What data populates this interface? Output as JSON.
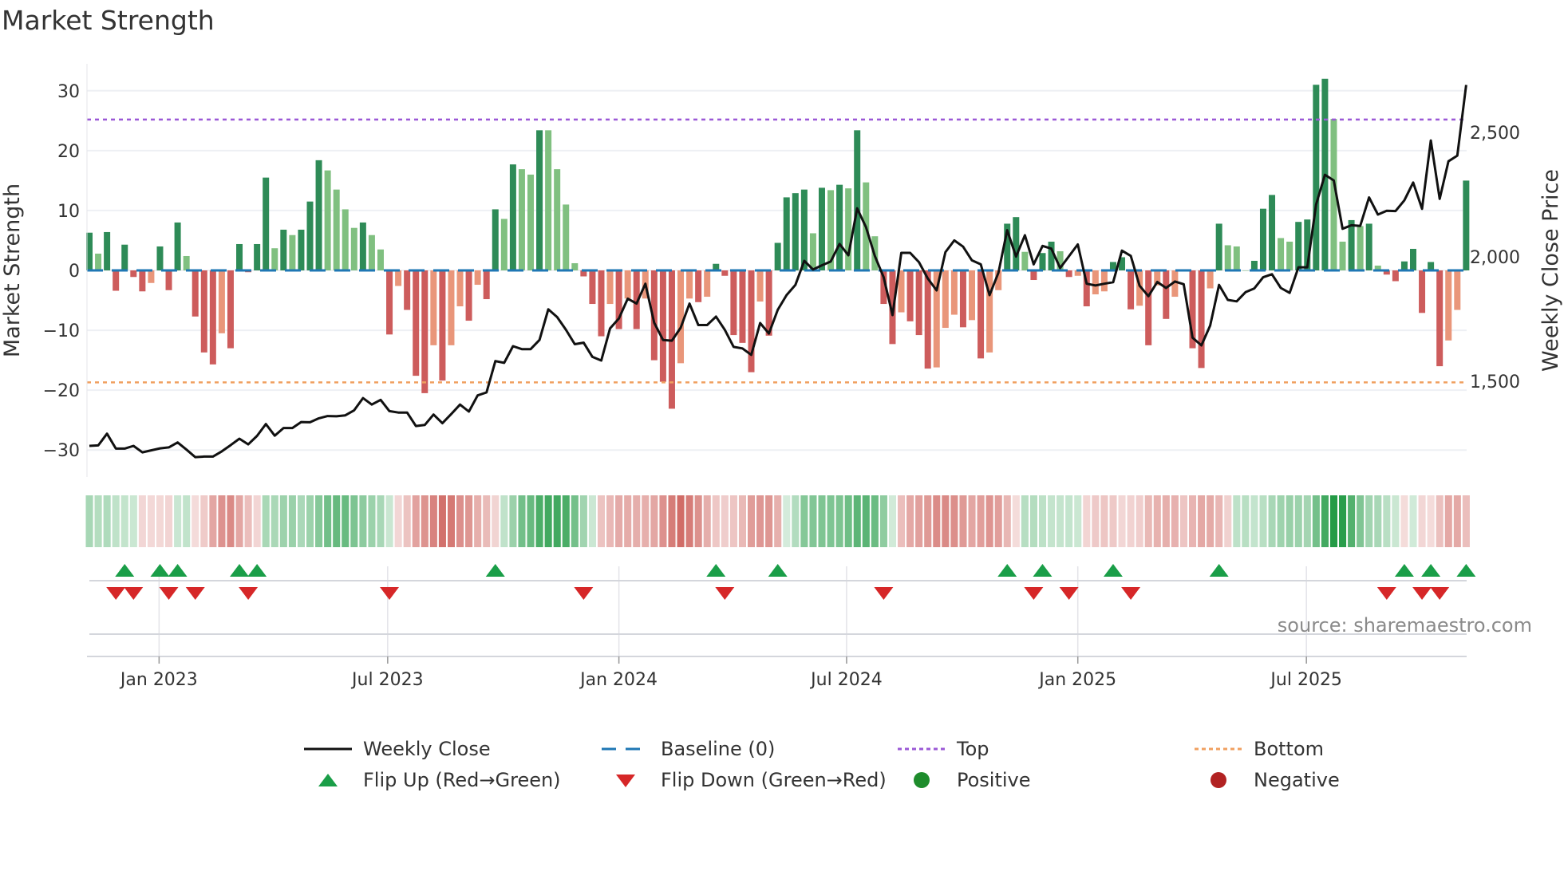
{
  "title": "Market Strength",
  "source": "source: sharemaestro.com",
  "legend": {
    "weekly_close": "Weekly Close",
    "baseline": "Baseline (0)",
    "top": "Top",
    "bottom": "Bottom",
    "flip_up": "Flip Up (Red→Green)",
    "flip_down": "Flip Down (Green→Red)",
    "positive": "Positive",
    "negative": "Negative"
  },
  "colors": {
    "strong_up": "#2e8b57",
    "weak_up": "#80c080",
    "strong_down": "#cd5c5c",
    "weak_down": "#e9967a",
    "baseline": "#1f77b4",
    "top": "#9b59d6",
    "bottom": "#f0a060",
    "line": "#111111",
    "flip_up": "#1a9e48",
    "flip_down": "#d62728",
    "positive": "#1e8c2c",
    "negative": "#b22222"
  },
  "chart_data": {
    "type": "bar",
    "title": "Market Strength",
    "ylabel": "Market Strength",
    "y2label": "Weekly Close Price",
    "ylim": [
      -34.5,
      34.5
    ],
    "y2lim": [
      1115,
      2776
    ],
    "yticks": [
      "30",
      "20",
      "10",
      "0",
      "−10",
      "−20",
      "−30"
    ],
    "ytick_values": [
      30,
      20,
      10,
      0,
      -10,
      -20,
      -30
    ],
    "y2ticks": [
      "2,500",
      "2,000",
      "1,500"
    ],
    "y2tick_values": [
      2500,
      2000,
      1500
    ],
    "xticks": [
      "Jan 2023",
      "Jul 2023",
      "Jan 2024",
      "Jul 2024",
      "Jan 2025",
      "Jul 2025"
    ],
    "xtick_week_index": [
      7.9,
      33.8,
      60,
      85.8,
      112,
      137.9
    ],
    "frequency": "weekly",
    "top_level": 25.2,
    "bottom_level": -18.7,
    "baseline": 0,
    "strength": [
      6.3,
      2.8,
      6.4,
      -3.4,
      4.3,
      -1.1,
      -3.5,
      -2.1,
      4,
      -3.3,
      8,
      2.4,
      -7.7,
      -13.7,
      -15.7,
      -10.5,
      -13,
      4.4,
      -0.3,
      4.4,
      15.5,
      3.7,
      6.8,
      5.9,
      6.8,
      11.5,
      18.4,
      16.7,
      13.5,
      10.2,
      7.1,
      8,
      5.9,
      3.5,
      -10.7,
      -2.6,
      -6.6,
      -17.6,
      -20.5,
      -12.5,
      -18.4,
      -12.5,
      -6,
      -8.4,
      -2.4,
      -4.8,
      10.2,
      8.6,
      17.7,
      16.9,
      16,
      23.4,
      23.4,
      16.9,
      11,
      1.2,
      -1,
      -5.6,
      -11,
      -5.6,
      -9.8,
      -4.7,
      -9.8,
      -4.7,
      -15,
      -18.6,
      -23.1,
      -15.5,
      -4.7,
      -5.3,
      -4.4,
      1.1,
      -0.9,
      -10.8,
      -12.1,
      -17,
      -5.2,
      -10.9,
      4.6,
      12.2,
      12.9,
      13.5,
      6.2,
      13.8,
      13.4,
      14.3,
      13.7,
      23.4,
      14.7,
      5.7,
      -5.6,
      -12.3,
      -7,
      -8.5,
      -10.8,
      -16.4,
      -16.2,
      -9.6,
      -7.4,
      -9.5,
      -8.3,
      -14.7,
      -13.7,
      -3.3,
      7.8,
      8.9,
      3.1,
      -1.6,
      2.9,
      4.8,
      3.2,
      -1.1,
      -0.9,
      -6,
      -4,
      -3.5,
      1.4,
      2.2,
      -6.5,
      -5.9,
      -12.5,
      -2.5,
      -8.1,
      -4.4,
      0,
      -13,
      -16.3,
      -3,
      7.8,
      4.2,
      4,
      0,
      1.6,
      10.3,
      12.6,
      5.4,
      4.8,
      8.1,
      8.5,
      31,
      32,
      25.3,
      4.8,
      8.4,
      7.4,
      7.8,
      0.8,
      -0.7,
      -1.8,
      1.5,
      3.6,
      -7.1,
      1.4,
      -16,
      -11.7,
      -6.6,
      15
    ],
    "strength_class": "GgGRGRRrGRGgRRRrRGRGGgGgGGGggggGggRrRRRrRrrRrRGgGggGgg",
    "strength_class_2": "ggRRRrRrRrRRRrrRrGRRRRrRGGGGgGgGgGggRRrRRRrrrRrRrrGGgRGGgRrRrrG",
    "strength_class_3": "GRrRrRrrRRrGgggGGGggGGGGggGgGgRRGGRGRrrG",
    "weekly_close": [
      1240,
      1242,
      1289,
      1229,
      1229,
      1240,
      1214,
      1222,
      1230,
      1234,
      1254,
      1225,
      1195,
      1197,
      1197,
      1218,
      1243,
      1269,
      1246,
      1280,
      1328,
      1281,
      1312,
      1312,
      1336,
      1335,
      1351,
      1360,
      1359,
      1363,
      1383,
      1432,
      1406,
      1425,
      1380,
      1374,
      1374,
      1320,
      1324,
      1366,
      1331,
      1368,
      1406,
      1378,
      1443,
      1455,
      1581,
      1574,
      1641,
      1629,
      1629,
      1666,
      1789,
      1758,
      1707,
      1649,
      1655,
      1598,
      1583,
      1712,
      1752,
      1832,
      1812,
      1892,
      1735,
      1666,
      1663,
      1715,
      1812,
      1726,
      1726,
      1760,
      1707,
      1638,
      1632,
      1606,
      1734,
      1692,
      1787,
      1846,
      1887,
      1984,
      1949,
      1966,
      1981,
      2052,
      2006,
      2195,
      2119,
      2004,
      1918,
      1766,
      2016,
      2016,
      1979,
      1913,
      1865,
      2019,
      2066,
      2041,
      1986,
      1970,
      1846,
      1936,
      2107,
      2001,
      2087,
      1970,
      2044,
      2033,
      1955,
      2003,
      2050,
      1892,
      1885,
      1892,
      1898,
      2025,
      2004,
      1884,
      1842,
      1899,
      1875,
      1901,
      1890,
      1675,
      1644,
      1724,
      1887,
      1827,
      1821,
      1858,
      1873,
      1918,
      1930,
      1875,
      1855,
      1958,
      1958,
      2210,
      2330,
      2307,
      2113,
      2127,
      2124,
      2239,
      2170,
      2185,
      2184,
      2227,
      2299,
      2193,
      2468,
      2233,
      2384,
      2407,
      2691
    ],
    "flip_up_week_index": [
      4,
      8,
      10,
      17,
      19,
      46,
      71,
      78,
      104,
      108,
      116,
      128,
      149,
      152,
      156
    ],
    "flip_down_week_index": [
      3,
      5,
      9,
      12,
      18,
      34,
      56,
      72,
      90,
      107,
      111,
      118,
      147,
      151,
      153
    ]
  }
}
